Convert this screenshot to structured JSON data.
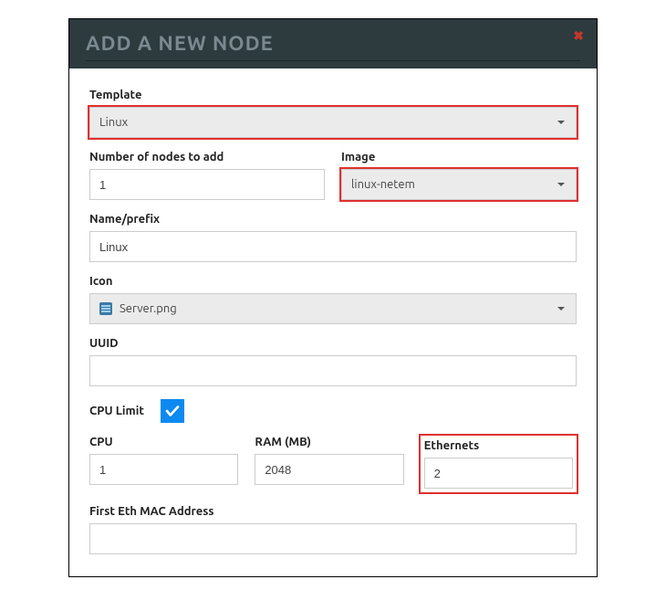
{
  "header": {
    "title": "ADD A NEW NODE"
  },
  "fields": {
    "template": {
      "label": "Template",
      "value": "Linux"
    },
    "num_nodes": {
      "label": "Number of nodes to add",
      "value": "1"
    },
    "image": {
      "label": "Image",
      "value": "linux-netem"
    },
    "name_prefix": {
      "label": "Name/prefix",
      "value": "Linux"
    },
    "icon": {
      "label": "Icon",
      "value": "Server.png"
    },
    "uuid": {
      "label": "UUID",
      "value": ""
    },
    "cpu_limit": {
      "label": "CPU Limit",
      "checked": true
    },
    "cpu": {
      "label": "CPU",
      "value": "1"
    },
    "ram": {
      "label": "RAM (MB)",
      "value": "2048"
    },
    "ethernets": {
      "label": "Ethernets",
      "value": "2"
    },
    "first_mac": {
      "label": "First Eth MAC Address",
      "value": ""
    }
  }
}
